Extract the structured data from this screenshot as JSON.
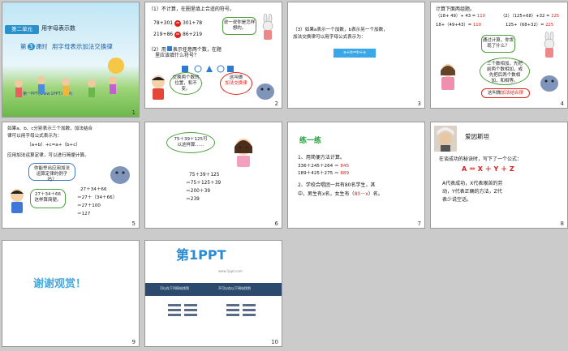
{
  "slides": [
    {
      "number": "1",
      "badge": "第二单元",
      "header": "用字母表示数",
      "lesson_prefix": "第",
      "lesson_num": "3",
      "lesson_rest": "课时",
      "lesson_title": "用字母表示加法交换律",
      "site": "第一PPT(www.1PPT.COM)"
    },
    {
      "number": "2",
      "q1": "（1）不计算，在圈里填上合适的符号。",
      "eq1_left": "78+301",
      "eq1_sym": "=",
      "eq1_right": "301+78",
      "eq2_left": "219+86",
      "eq2_sym": "=",
      "eq2_right": "86+219",
      "bubble1": "说一说你是怎样想的。",
      "q2a": "（2）用",
      "q2b": "表示任意两个数，在题",
      "q2c": "里应该填什么符号？",
      "bubble2": "交换两个数的位置，和不变。",
      "bubble3_a": "这叫做",
      "bubble3_b": "加法交换律"
    },
    {
      "number": "3",
      "line1": "（3）如果a表示一个加数，b表示另一个加数，",
      "line2": "加法交换律可以用字母公式表示为：",
      "formula": "a+b=b+a"
    },
    {
      "number": "4",
      "title": "计算下面两组题。",
      "r1a": "（18+ 49）+ 43 =",
      "r1a_ans": "110",
      "r1b": "（2）（125+68）+32 =",
      "r1b_ans": "225",
      "r2a": "18+（49+43）=",
      "r2a_ans": "110",
      "r2b": "125+（68+32）=",
      "r2b_ans": "225",
      "bubble1": "通过计算，你发现了什么？",
      "bubble2": "三个数相加，先把前两个数相加，或先把后两个数相加，和相等。",
      "bubble3_a": "这叫做",
      "bubble3_b": "加法结合律"
    },
    {
      "number": "5",
      "line1": "如果a、b、c分别表示三个加数，加法结合",
      "line2": "律可以用字母公式表示为：",
      "formula": "（a+b）+c=a+（b+c）",
      "line3": "应用加法运算定律，可以进行简便计算。",
      "bubble1": "你能举出应用加法运算定律的例子吗？",
      "bubble2": "27＋34＋66 这样算简便。",
      "calc": [
        "27＋34＋66",
        "＝27＋（34＋66）",
        "＝27＋100",
        "＝127"
      ]
    },
    {
      "number": "6",
      "bubble": "75＋39＋125可以这样算……",
      "calc": [
        "75＋39＋125",
        "＝75＋125＋39",
        "＝200＋39",
        "＝239"
      ]
    },
    {
      "number": "7",
      "heading": "练一练",
      "l1": "1、用简便方法计算。",
      "l2": "336＋245＋264 ＝",
      "l2_ans": "845",
      "l3": "189＋425＋275 ＝",
      "l3_ans": "889",
      "l4": "2、学校合唱团一共有80名学生，其",
      "l5a": "中，男生有x名，女生有（",
      "l5_ans": "80－x",
      "l5b": "）名。"
    },
    {
      "number": "8",
      "name": "爱因斯坦",
      "l1": "在谈成功的秘诀时，写下了一个公式：",
      "formula": "A ＝ X ＋ Y ＋ Z",
      "l2": "A代表成功，X代表艰苦的劳",
      "l3": "动，Y代表正确的方法，Z代",
      "l4": "表少说空话。"
    },
    {
      "number": "9",
      "thanks": "谢谢观赏！"
    },
    {
      "number": "10",
      "logo_main": "第1PPT",
      "logo_sub": "www.1ppt.com",
      "col1": "可以在下列网站找到",
      "col2": "不可以在以下网站找到"
    }
  ]
}
